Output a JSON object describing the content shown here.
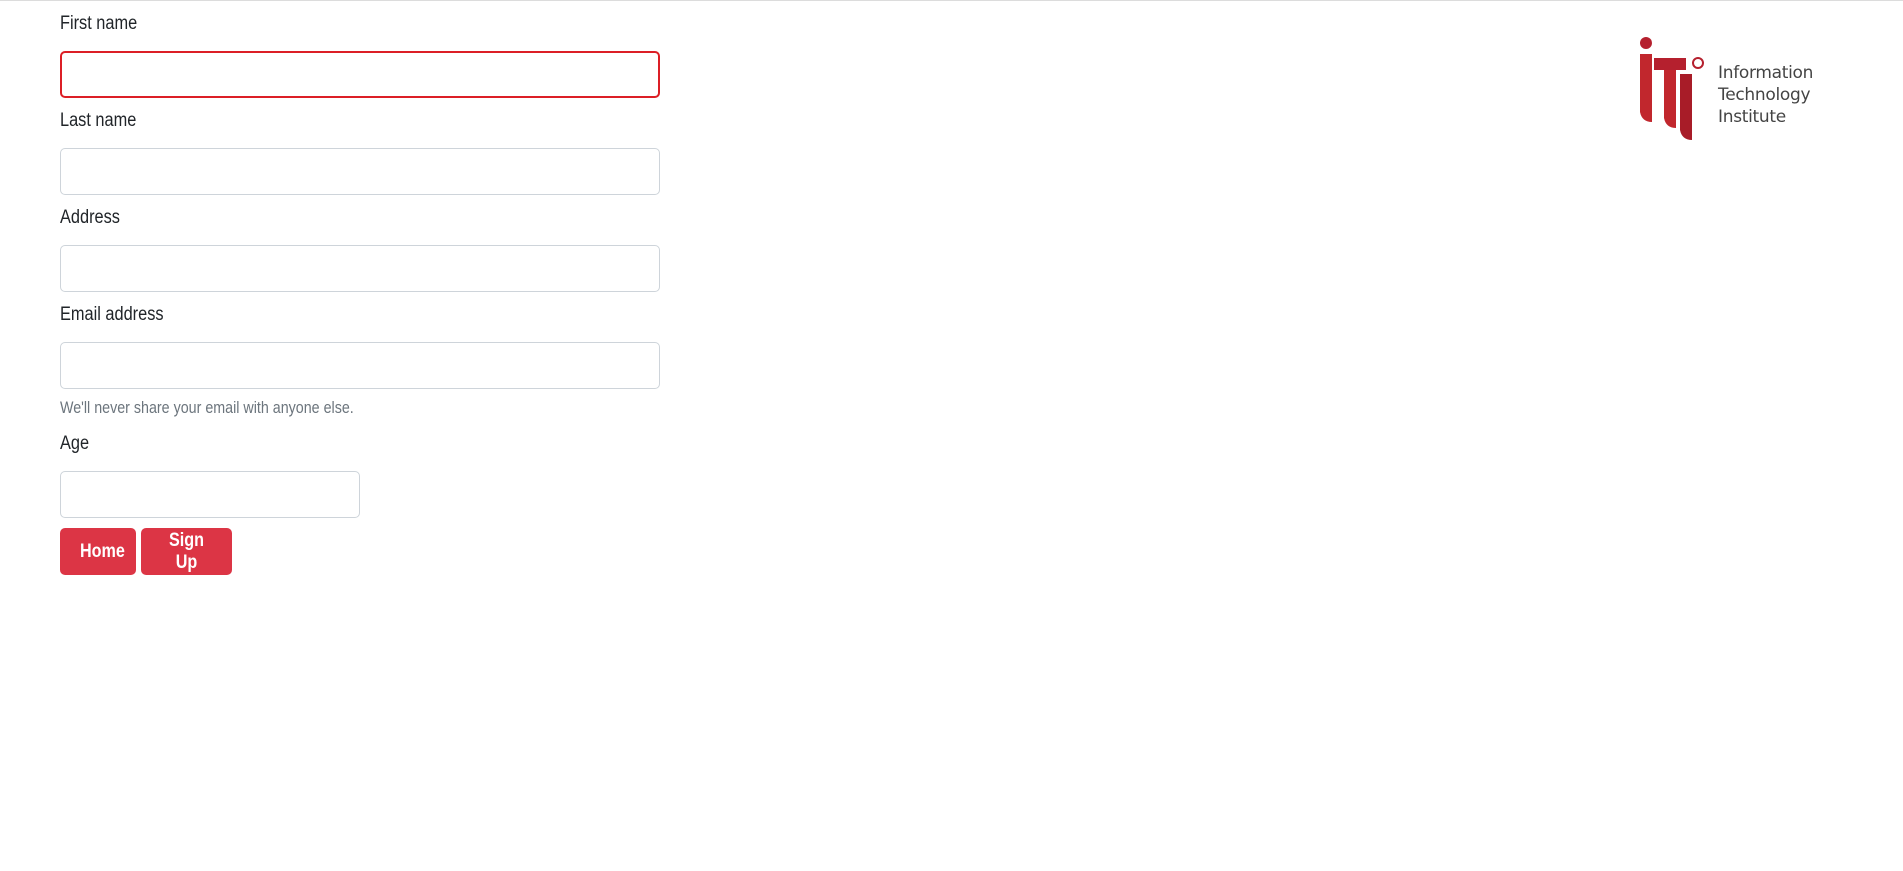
{
  "form": {
    "first_name": {
      "label": "First name",
      "value": "",
      "placeholder": ""
    },
    "last_name": {
      "label": "Last name",
      "value": "",
      "placeholder": ""
    },
    "address": {
      "label": "Address",
      "value": "",
      "placeholder": ""
    },
    "email": {
      "label": "Email address",
      "value": "",
      "placeholder": "",
      "help": "We'll never share your email with anyone else."
    },
    "age": {
      "label": "Age",
      "value": "",
      "placeholder": ""
    }
  },
  "actions": {
    "home_label": "Home",
    "signup_label": "Sign Up"
  },
  "logo": {
    "line1": "Information",
    "line2": "Technology",
    "line3": "Institute"
  },
  "colors": {
    "accent": "#dc3545",
    "logo_red": "#b5202e",
    "invalid_border": "#dc1f26"
  }
}
